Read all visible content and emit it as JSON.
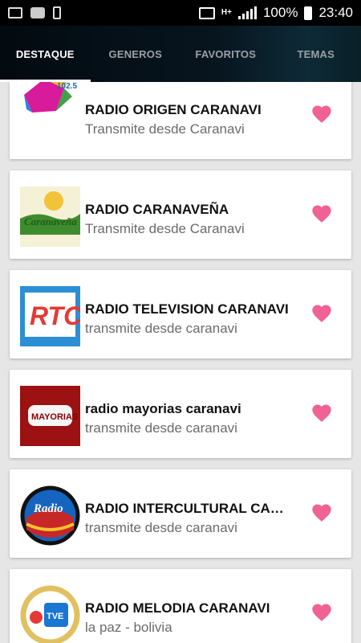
{
  "status": {
    "battery_percent": "100%",
    "time": "23:40",
    "network": "H+"
  },
  "tabs": [
    {
      "label": "DESTAQUE",
      "active": true
    },
    {
      "label": "GENEROS",
      "active": false
    },
    {
      "label": "FAVORITOS",
      "active": false
    },
    {
      "label": "TEMAS",
      "active": false
    }
  ],
  "stations": [
    {
      "name": "RADIO ORIGEN CARANAVI",
      "subtitle": "Transmite desde Caranavi",
      "logo_text": "102.5",
      "favorite_color": "#f06292"
    },
    {
      "name": "RADIO CARANAVEÑA",
      "subtitle": "Transmite desde Caranavi",
      "logo_text": "Caranaveña",
      "favorite_color": "#f06292"
    },
    {
      "name": "RADIO TELEVISION CARANAVI",
      "subtitle": "transmite desde caranavi",
      "logo_text": "RTC",
      "favorite_color": "#f06292"
    },
    {
      "name": "radio mayorias caranavi",
      "subtitle": "transmite desde caranavi",
      "logo_text": "MAYORIAS",
      "favorite_color": "#f06292"
    },
    {
      "name": "RADIO INTERCULTURAL CARANAVI",
      "subtitle": "transmite desde caranavi",
      "logo_text": "Radio",
      "favorite_color": "#f06292"
    },
    {
      "name": "RADIO MELODIA CARANAVI",
      "subtitle": "la paz - bolivia",
      "logo_text": "TVE",
      "favorite_color": "#f06292"
    }
  ]
}
